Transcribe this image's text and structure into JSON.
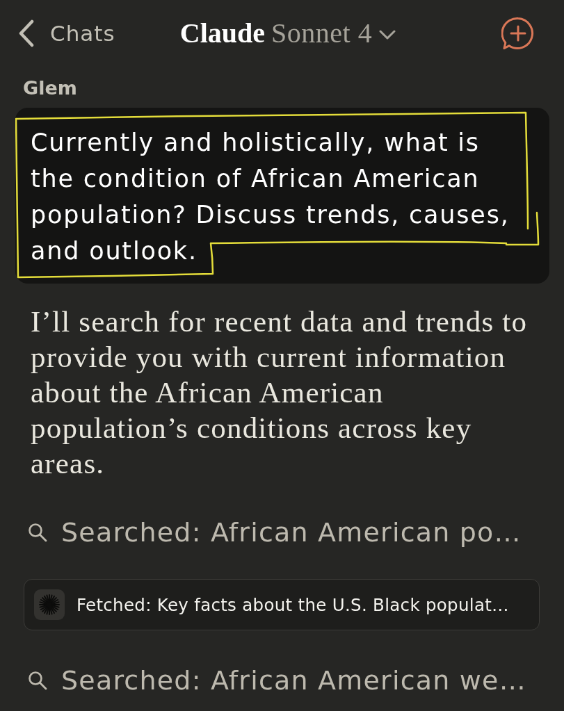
{
  "header": {
    "back_label": "Chats",
    "title": "Claude",
    "model": "Sonnet 4"
  },
  "chat_name": "Glem",
  "user_message": {
    "text": "Currently and holistically, what is the condition of African American population? Discuss trends, causes, and outlook.",
    "highlighted": true
  },
  "assistant_message": {
    "text": "I’ll search for recent data and trends to provide you with current information about the African American population’s conditions across key areas."
  },
  "tool_steps": [
    {
      "kind": "search",
      "text": "Searched: African American po…"
    },
    {
      "kind": "fetch",
      "text": "Fetched: Key facts about the U.S. Black populat…"
    },
    {
      "kind": "search",
      "text": "Searched: African American we…"
    }
  ]
}
